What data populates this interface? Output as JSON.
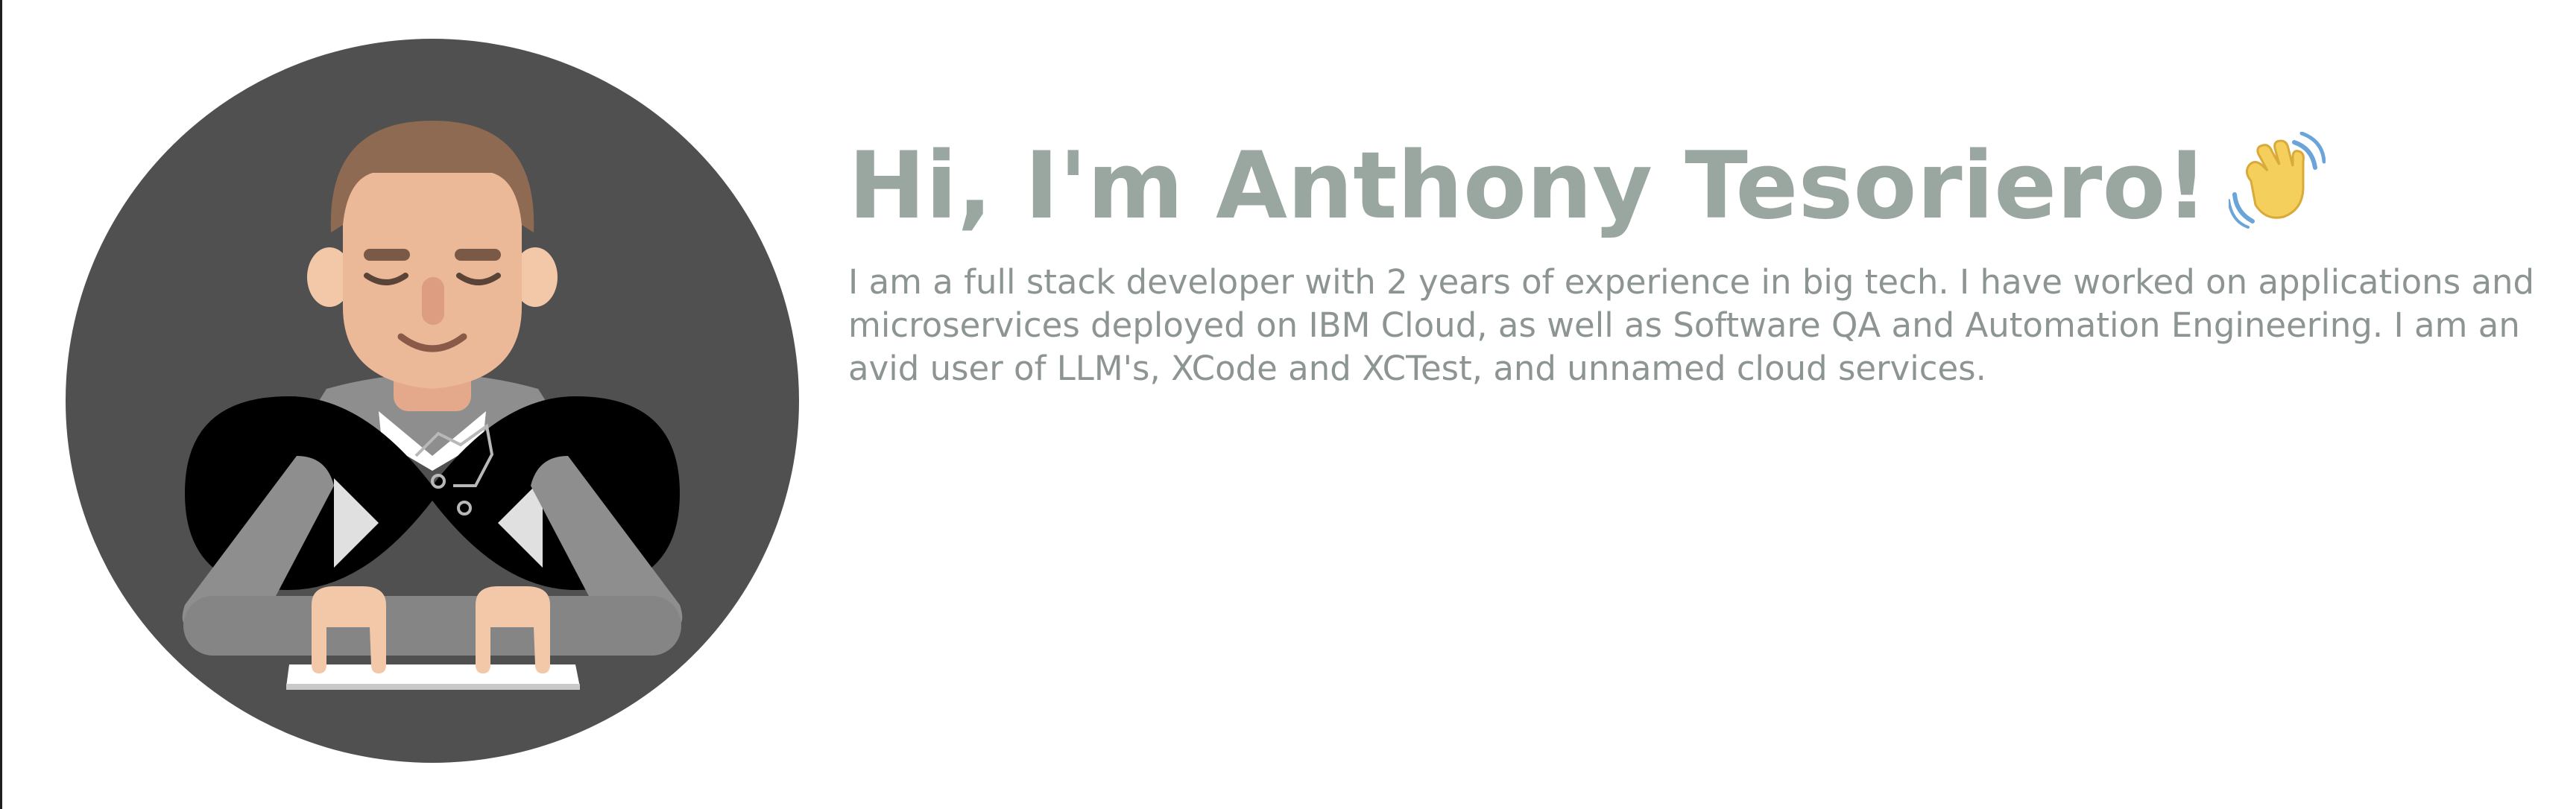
{
  "hero": {
    "greeting": "Hi, I'm Anthony Tesoriero!",
    "wave_icon": "waving-hand-icon",
    "bio": "I am a full stack developer with 2 years of experience in big tech. I have worked on applications and microservices deployed on IBM Cloud, as well as Software QA and Automation Engineering. I am an avid user of LLM's, XCode and XCTest, and unnamed cloud services."
  },
  "avatar": {
    "icon": "developer-avatar-icon"
  },
  "colors": {
    "heading": "#9aa6a0",
    "text": "#8c9592",
    "circle": "#505050",
    "background": "#ffffff"
  }
}
